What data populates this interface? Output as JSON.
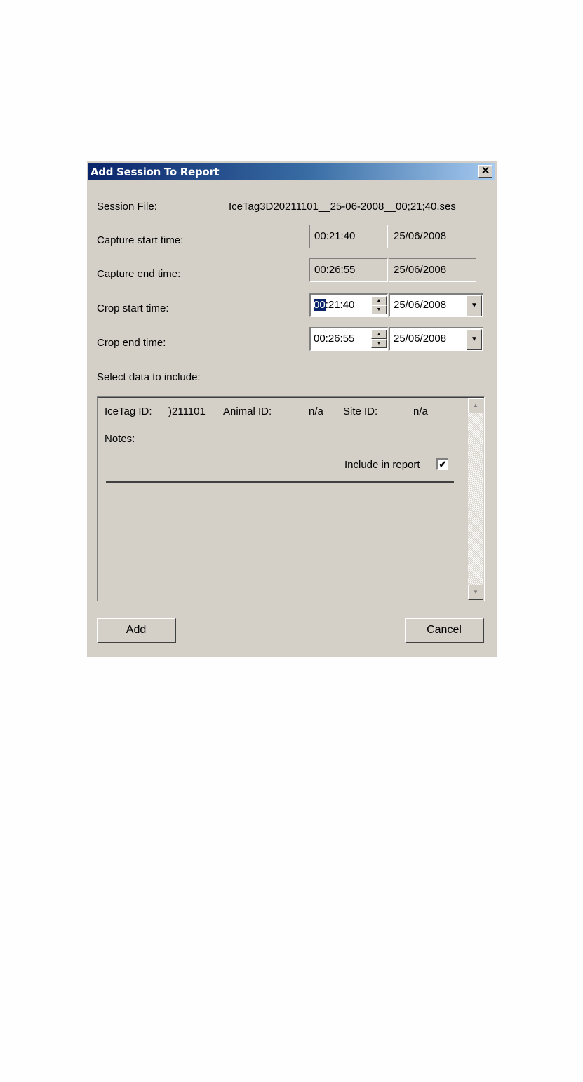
{
  "dialog": {
    "title": "Add Session To Report",
    "close_glyph": "✕"
  },
  "session_file": {
    "label": "Session File:",
    "value": "IceTag3D20211101__25-06-2008__00;21;40.ses"
  },
  "capture_start": {
    "label": "Capture start time:",
    "time": "00:21:40",
    "date": "25/06/2008"
  },
  "capture_end": {
    "label": "Capture end time:",
    "time": "00:26:55",
    "date": "25/06/2008"
  },
  "crop_start": {
    "label": "Crop start time:",
    "time_selected": "00",
    "time_rest": ":21:40",
    "date": "25/06/2008"
  },
  "crop_end": {
    "label": "Crop end time:",
    "time": "00:26:55",
    "date": "25/06/2008"
  },
  "select_label": "Select data to include:",
  "data_item": {
    "icetag_label": "IceTag ID:",
    "icetag_value": ")211101",
    "animal_label": "Animal ID:",
    "animal_value": "n/a",
    "site_label": "Site ID:",
    "site_value": "n/a",
    "notes_label": "Notes:",
    "include_label": "Include in report",
    "include_checked": true,
    "check_glyph": "✔"
  },
  "icons": {
    "spin_up": "up-arrow-icon",
    "spin_down": "down-arrow-icon",
    "dropdown": "chevron-down-icon"
  },
  "buttons": {
    "add": "Add",
    "cancel": "Cancel"
  }
}
